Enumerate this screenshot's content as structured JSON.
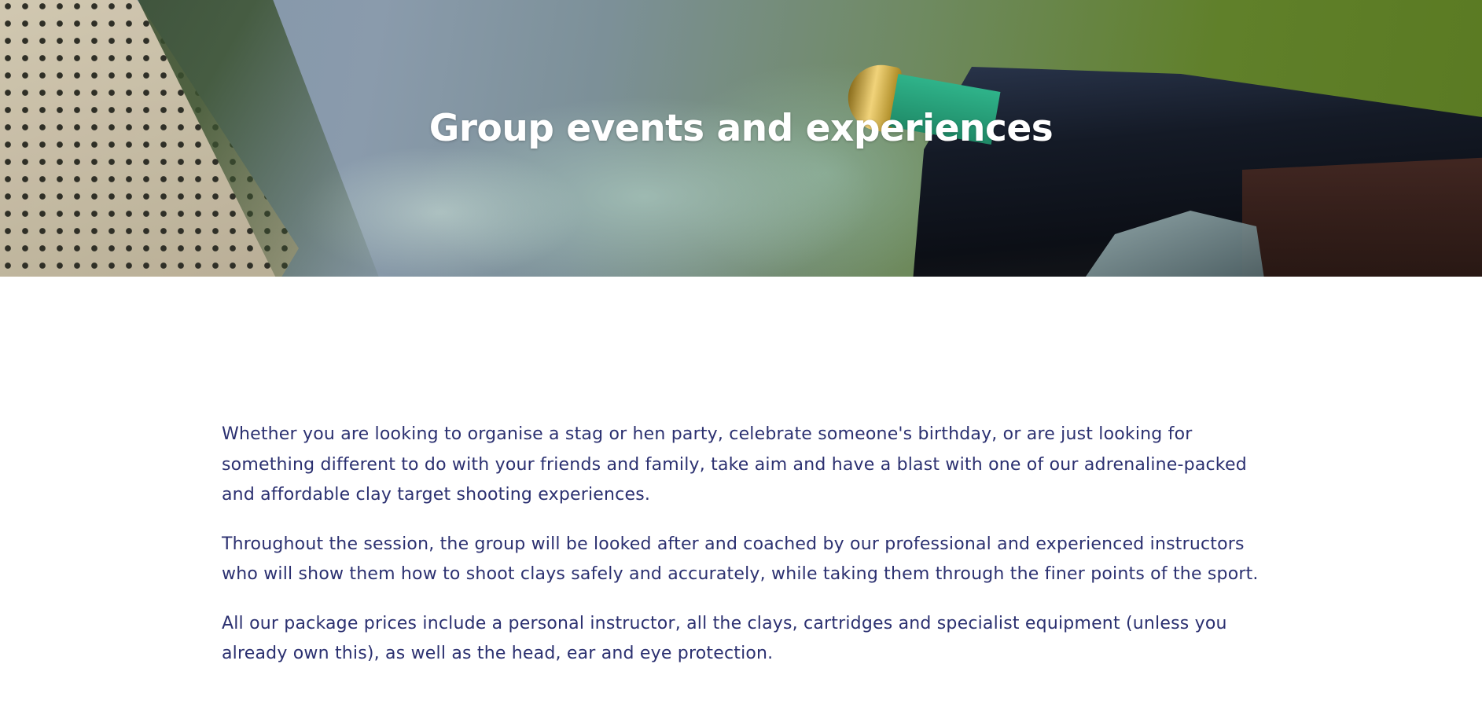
{
  "hero": {
    "title": "Group events and experiences"
  },
  "intro": {
    "paragraphs": [
      "Whether you are looking to organise a stag or hen party, celebrate someone's birthday, or are just looking for something different to do with your friends and family, take aim and have a blast with one of our adrenaline-packed and affordable clay target shooting experiences.",
      "Throughout the session, the group will be looked after and coached by our professional and experienced instructors who will show them how to shoot clays safely and accurately, while taking them through the finer points of the sport.",
      "All our package prices include a personal instructor, all the clays, cartridges and specialist equipment (unless you already own this), as well as the head, ear and eye protection."
    ]
  },
  "colors": {
    "body_text": "#2b3070",
    "hero_title": "#ffffff"
  }
}
